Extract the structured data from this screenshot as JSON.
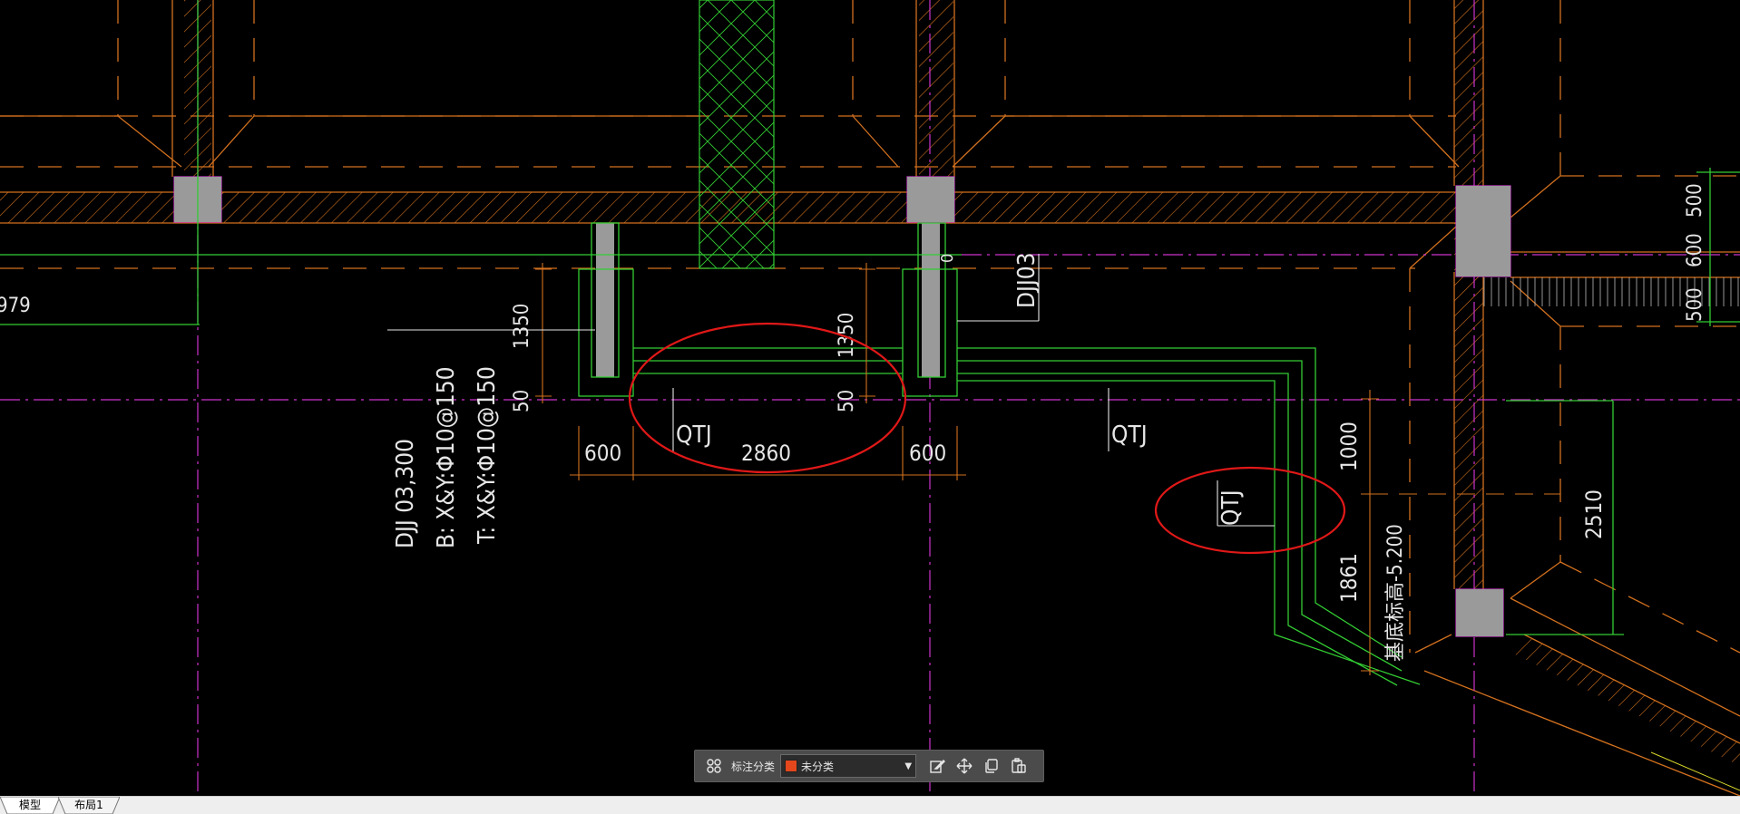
{
  "drawing": {
    "dimensions": {
      "d979": "979",
      "d1350_left": "1350",
      "d50_left": "50",
      "d1350_mid": "1350",
      "d50_mid": "50",
      "d600_left": "600",
      "d2860": "2860",
      "d600_right": "600",
      "d0": "0",
      "d500_top": "500",
      "d600_vert": "600",
      "d500_bottom": "500",
      "d1000": "1000",
      "d2510": "2510",
      "d1861": "1861"
    },
    "labels": {
      "qtj_left": "QTJ",
      "qtj_right": "QTJ",
      "qtj_side": "QTJ",
      "djj03_tag": "DJJ03",
      "footing_name": "DJJ 03,300",
      "bottom_rebar": "B: X&Y:Φ10@150",
      "top_rebar": "T: X&Y:Φ10@150",
      "base_elevation": "基底标高-5.200"
    },
    "colors": {
      "background": "#000000",
      "orange": "#d2701e",
      "green": "#33cc33",
      "magenta": "#cc33cc",
      "white": "#e6e6e6",
      "grey_column": "#9a9a9a",
      "annotation_red": "#e01818"
    }
  },
  "toolbar": {
    "category_label": "标注分类",
    "selected_value": "未分类",
    "swatch_color": "#e4471c",
    "icons": [
      "layout-icon",
      "edit-icon",
      "move-icon",
      "copy-icon",
      "paste-icon"
    ]
  },
  "tabs": {
    "model": "模型",
    "layout1": "布局1"
  }
}
